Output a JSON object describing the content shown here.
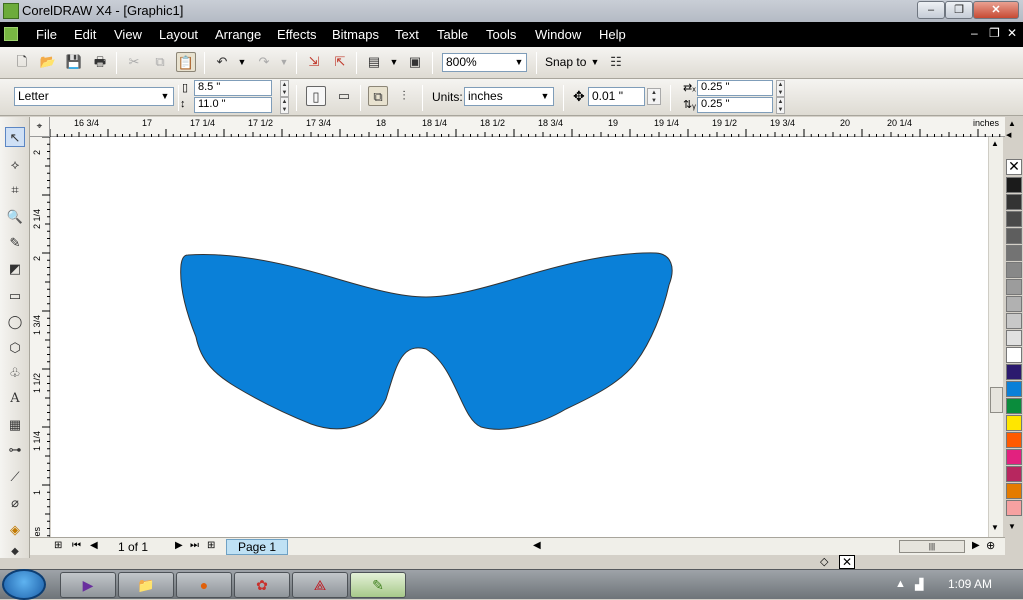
{
  "window": {
    "title": "CorelDRAW X4 - [Graphic1]"
  },
  "menu": [
    "File",
    "Edit",
    "View",
    "Layout",
    "Arrange",
    "Effects",
    "Bitmaps",
    "Text",
    "Table",
    "Tools",
    "Window",
    "Help"
  ],
  "menu_hotkeys": [
    "F",
    "E",
    "V",
    "L",
    "A",
    "c",
    "B",
    "T",
    "T",
    "o",
    "W",
    "H"
  ],
  "standard_toolbar": {
    "zoom": "800%",
    "snap_to": "Snap to"
  },
  "property_bar": {
    "paper_type": "Letter",
    "width": "8.5 \"",
    "height": "11.0 \"",
    "units_label": "Units:",
    "units": "inches",
    "nudge": "0.01 \"",
    "dup_x": "0.25 \"",
    "dup_y": "0.25 \""
  },
  "ruler": {
    "unit": "inches",
    "h_labels": [
      "16  3/4",
      "17",
      "17  1/4",
      "17  1/2",
      "17  3/4",
      "18",
      "18  1/4",
      "18  1/2",
      "18  3/4",
      "19",
      "19  1/4",
      "19  1/2",
      "19  3/4",
      "20",
      "20  1/4",
      "inches"
    ],
    "v_labels": [
      "2",
      "2  1/4",
      "2",
      "1  3/4",
      "1  1/2",
      "1  1/4",
      "1",
      "inches"
    ]
  },
  "navigator": {
    "page_count": "1 of 1",
    "page_tab": "Page 1"
  },
  "palette": [
    "#1b1b1b",
    "#333333",
    "#4a4a4a",
    "#5e5e5e",
    "#737373",
    "#888888",
    "#9c9c9c",
    "#b1b1b1",
    "#c8c8c8",
    "#e0e0e0",
    "#ffffff",
    "#2b1a6e",
    "#0a80d8",
    "#0a8c3c",
    "#ffe600",
    "#ff5a00",
    "#e2217f",
    "#b7275f",
    "#e47b00",
    "#f6a1a1"
  ],
  "shape": {
    "fill": "#0a80d8",
    "stroke": "#333333"
  },
  "taskbar": {
    "time": "1:09 AM"
  }
}
